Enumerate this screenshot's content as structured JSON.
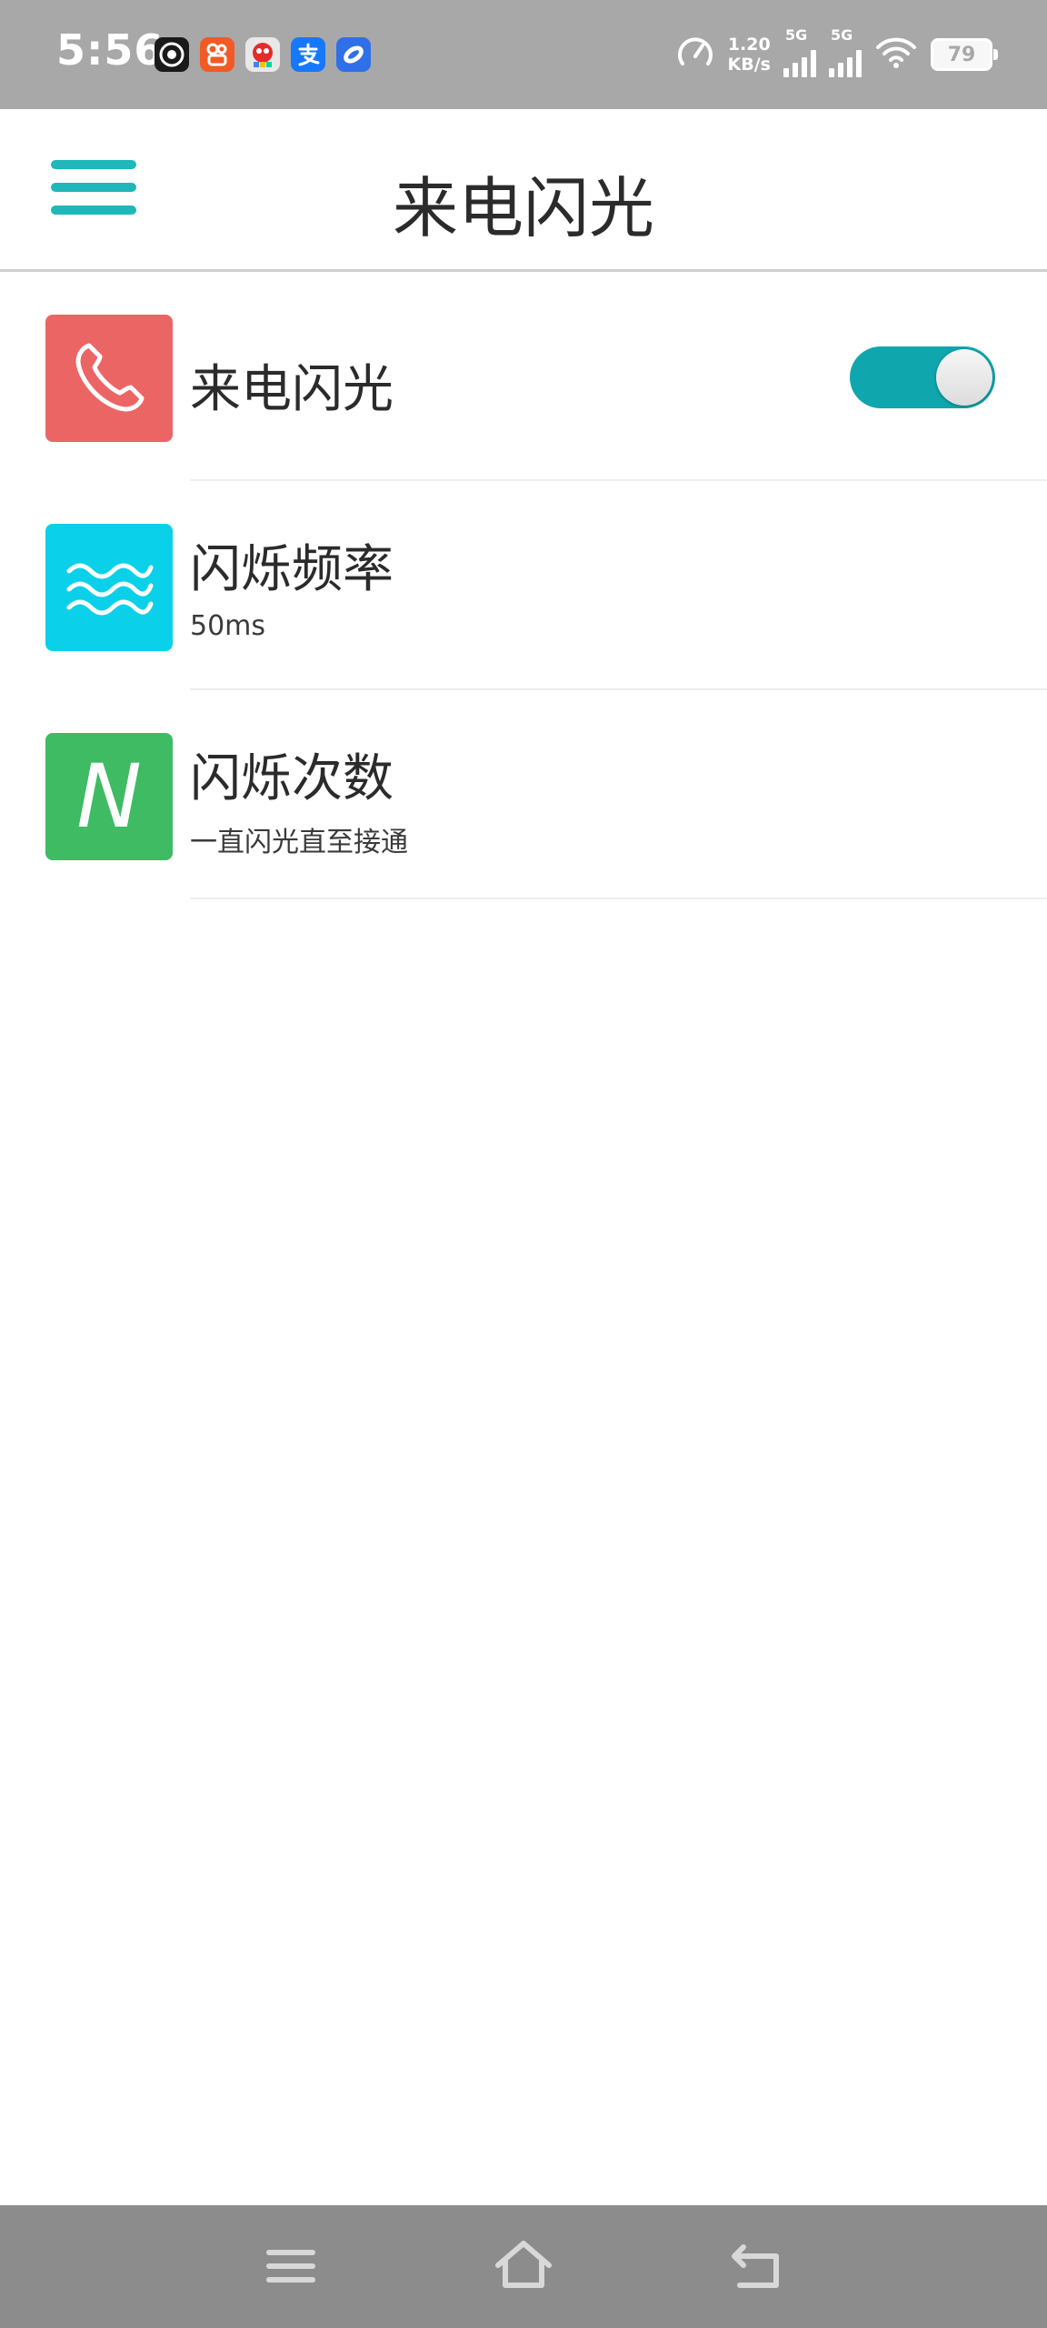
{
  "status_bar": {
    "time": "5:56",
    "net_speed_value": "1.20",
    "net_speed_unit": "KB/s",
    "signal_1_label": "5G",
    "signal_2_label": "5G",
    "battery_level": "79"
  },
  "app_bar": {
    "title": "来电闪光"
  },
  "settings": [
    {
      "title": "来电闪光",
      "subtitle": "",
      "icon": "phone-icon",
      "icon_color": "#ec6565",
      "toggle_on": true
    },
    {
      "title": "闪烁频率",
      "subtitle": "50ms",
      "icon": "waves-icon",
      "icon_color": "#0ad1e9"
    },
    {
      "title": "闪烁次数",
      "subtitle": "一直闪光直至接通",
      "icon": "letter-n-icon",
      "icon_glyph": "N",
      "icon_color": "#3fbb63"
    }
  ],
  "colors": {
    "accent": "#1fb7b9",
    "toggle_on": "#0fa6ad",
    "status_bar_bg": "#a8a8a8",
    "nav_bar_bg": "#8c8c8c"
  }
}
